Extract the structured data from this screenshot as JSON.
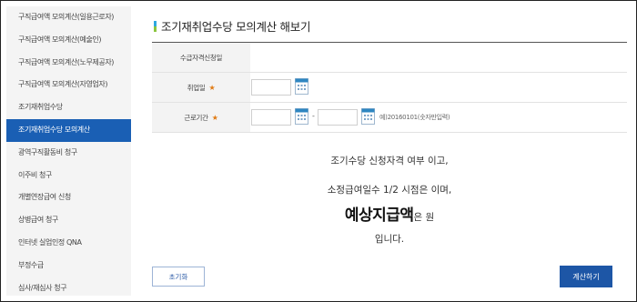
{
  "sidebar": {
    "items": [
      {
        "label": "구직급여액 모의계산(일용근로자)"
      },
      {
        "label": "구직급여액 모의계산(예술인)"
      },
      {
        "label": "구직급여액 모의계산(노무제공자)"
      },
      {
        "label": "구직급여액 모의계산(자영업자)"
      },
      {
        "label": "조기재취업수당"
      },
      {
        "label": "조기재취업수당 모의계산",
        "active": true
      },
      {
        "label": "광역구직활동비 청구"
      },
      {
        "label": "이주비 청구"
      },
      {
        "label": "개별연장급여 신청"
      },
      {
        "label": "상병급여 청구"
      },
      {
        "label": "인터넷 실업인정 QNA"
      },
      {
        "label": "부정수급"
      },
      {
        "label": "심사/재심사 청구"
      }
    ]
  },
  "main": {
    "title": "조기재취업수당 모의계산 해보기",
    "form": {
      "applicant_label": "수급자격신청일",
      "employment_date_label": "취업일",
      "work_period_label": "근로기간",
      "required_mark": "★",
      "period_separator": "-",
      "date_hint": "예)20160101(숫자만입력)",
      "employment_date_value": "",
      "period_start_value": "",
      "period_end_value": ""
    },
    "result": {
      "line1": "조기수당 신청자격 여부 이고,",
      "line2": "소정급여일수 1/2 시점은 이며,",
      "line3_big": "예상지급액",
      "line3_small": "은 원",
      "line4": "입니다."
    },
    "buttons": {
      "reset": "초기화",
      "calculate": "계산하기"
    }
  },
  "colors": {
    "active_nav": "#1a5fb4",
    "primary_button": "#1d56a6",
    "required_mark": "#e07a12",
    "calendar_icon": "#2e86c1"
  }
}
